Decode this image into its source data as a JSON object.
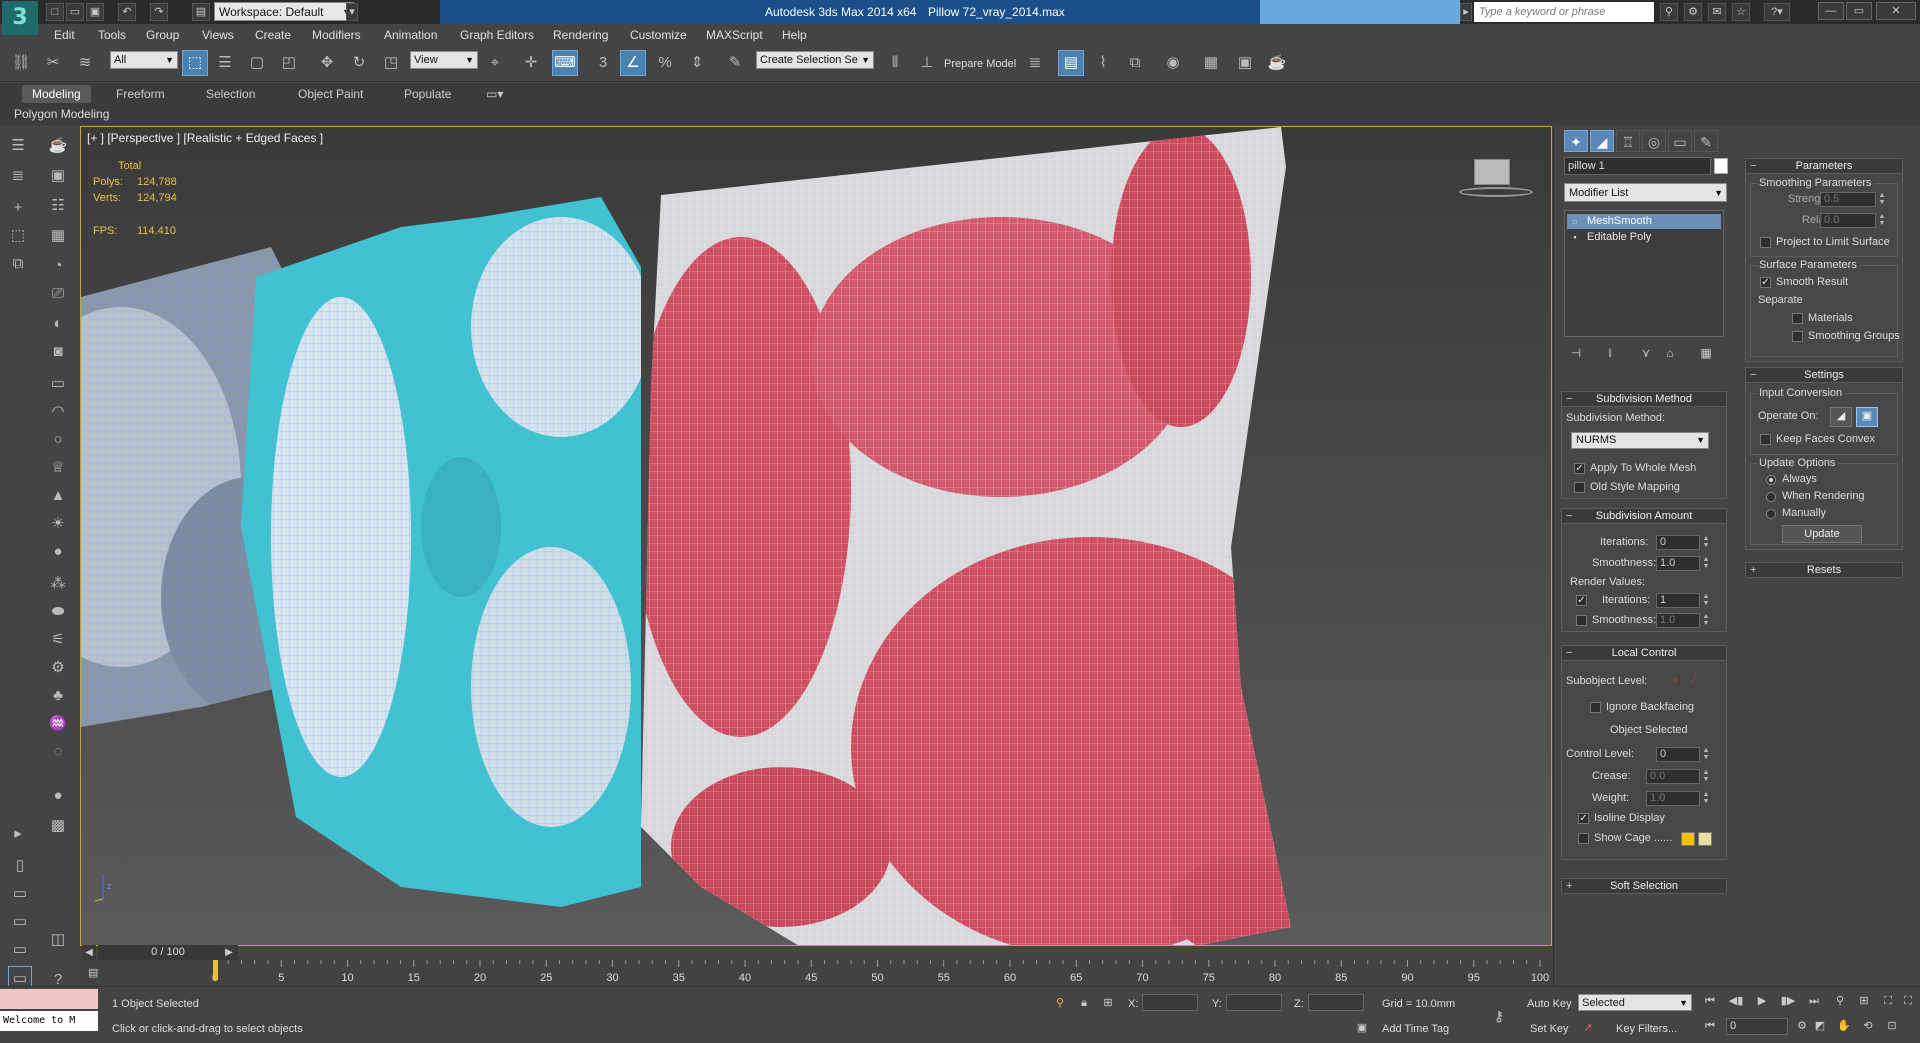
{
  "window": {
    "app_title": "Autodesk 3ds Max  2014 x64",
    "file_name": "Pillow 72_vray_2014.max",
    "workspace": "Workspace: Default",
    "search_placeholder": "Type a keyword or phrase"
  },
  "menu": [
    "Edit",
    "Tools",
    "Group",
    "Views",
    "Create",
    "Modifiers",
    "Animation",
    "Graph Editors",
    "Rendering",
    "Customize",
    "MAXScript",
    "Help"
  ],
  "toolbar": {
    "selection_filter": "All",
    "ref_coord": "View",
    "named_selection": "Create Selection Se",
    "prepare_model": "Prepare Model"
  },
  "ribbon": {
    "tabs": [
      "Modeling",
      "Freeform",
      "Selection",
      "Object Paint",
      "Populate"
    ],
    "sub_label": "Polygon Modeling"
  },
  "viewport": {
    "label": "[+ ] [Perspective ] [Realistic + Edged Faces ]",
    "stats_total": "Total",
    "polys_label": "Polys:",
    "polys_value": "124,788",
    "verts_label": "Verts:",
    "verts_value": "124,794",
    "fps_label": "FPS:",
    "fps_value": "114.410",
    "frame_counter": "0 / 100",
    "axis_z": "z"
  },
  "command_panel": {
    "object_name": "pillow 1",
    "modifier_list": "Modifier List",
    "stack": [
      "MeshSmooth",
      "Editable Poly"
    ],
    "subdivision_method": {
      "title": "Subdivision Method",
      "label": "Subdivision Method:",
      "value": "NURMS",
      "apply_whole_mesh": "Apply To Whole Mesh",
      "old_style_mapping": "Old Style Mapping"
    },
    "subdivision_amount": {
      "title": "Subdivision Amount",
      "iterations_label": "Iterations:",
      "iterations_value": "0",
      "smoothness_label": "Smoothness:",
      "smoothness_value": "1.0",
      "render_values": "Render Values:",
      "r_iterations_label": "Iterations:",
      "r_iterations_value": "1",
      "r_smoothness_label": "Smoothness:",
      "r_smoothness_value": "1.0"
    },
    "local_control": {
      "title": "Local Control",
      "subobject_level": "Subobject Level:",
      "ignore_backfacing": "Ignore Backfacing",
      "object_selected": "Object Selected",
      "control_level_label": "Control Level:",
      "control_level_value": "0",
      "crease_label": "Crease:",
      "crease_value": "0.0",
      "weight_label": "Weight:",
      "weight_value": "1.0",
      "isoline_display": "Isoline Display",
      "show_cage": "Show Cage ......",
      "cage_color_1": "#f2c200",
      "cage_color_2": "#e8e0a0"
    },
    "soft_selection": "Soft Selection",
    "parameters": {
      "title": "Parameters",
      "smoothing_params": "Smoothing Parameters",
      "strength_label": "Strength:",
      "strength_value": "0.5",
      "relax_label": "Relax:",
      "relax_value": "0.0",
      "project_limit": "Project to Limit Surface",
      "surface_params": "Surface Parameters",
      "smooth_result": "Smooth Result",
      "separate": "Separate",
      "materials": "Materials",
      "smoothing_groups": "Smoothing Groups"
    },
    "settings": {
      "title": "Settings",
      "input_conversion": "Input Conversion",
      "operate_on": "Operate On:",
      "keep_faces_convex": "Keep Faces Convex",
      "update_options": "Update Options",
      "always": "Always",
      "when_rendering": "When Rendering",
      "manually": "Manually",
      "update_button": "Update"
    },
    "resets": "Resets"
  },
  "timeline": {
    "ticks": [
      "0",
      "5",
      "10",
      "15",
      "20",
      "25",
      "30",
      "35",
      "40",
      "45",
      "50",
      "55",
      "60",
      "65",
      "70",
      "75",
      "80",
      "85",
      "90",
      "95",
      "100"
    ]
  },
  "statusbar": {
    "maxscript_text": "Welcome to M",
    "selected_text": "1 Object Selected",
    "prompt_text": "Click or click-and-drag to select objects",
    "x_label": "X:",
    "y_label": "Y:",
    "z_label": "Z:",
    "grid_text": "Grid = 10.0mm",
    "add_time_tag": "Add Time Tag",
    "auto_key": "Auto Key",
    "set_key": "Set Key",
    "selected_dropdown": "Selected",
    "key_filters": "Key Filters...",
    "frame_value": "0"
  }
}
